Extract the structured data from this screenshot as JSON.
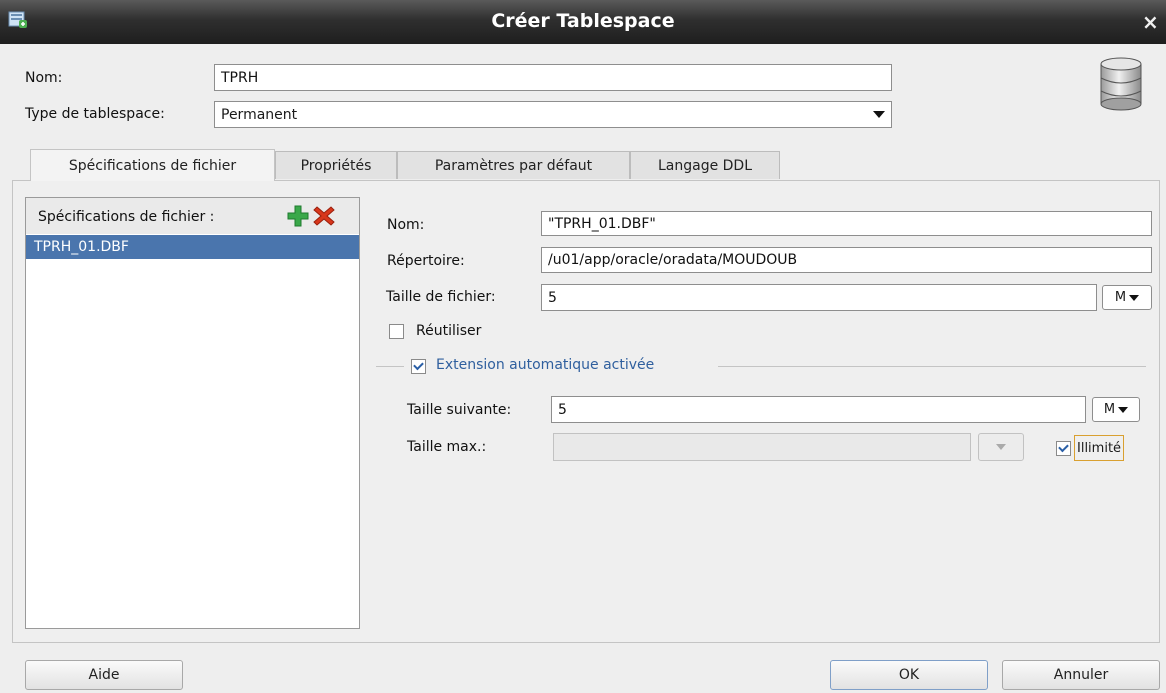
{
  "window": {
    "title": "Créer Tablespace",
    "close_glyph": "×"
  },
  "header": {
    "nom_label": "Nom:",
    "nom_value": "TPRH",
    "type_label": "Type de tablespace:",
    "type_value": "Permanent"
  },
  "tabs": [
    {
      "label": "Spécifications de fichier",
      "active": true
    },
    {
      "label": "Propriétés",
      "active": false
    },
    {
      "label": "Paramètres par défaut",
      "active": false
    },
    {
      "label": "Langage DDL",
      "active": false
    }
  ],
  "file_list": {
    "header_label": "Spécifications de fichier :",
    "items": [
      "TPRH_01.DBF"
    ]
  },
  "file_spec": {
    "nom_label": "Nom:",
    "nom_value": "\"TPRH_01.DBF\"",
    "repertoire_label": "Répertoire:",
    "repertoire_value": "/u01/app/oracle/oradata/MOUDOUB",
    "taille_label": "Taille de fichier:",
    "taille_value": "5",
    "taille_unit": "M",
    "reutiliser_label": "Réutiliser",
    "reutiliser_checked": false,
    "autoext_label": "Extension automatique activée",
    "autoext_checked": true,
    "suivante_label": "Taille suivante:",
    "suivante_value": "5",
    "suivante_unit": "M",
    "max_label": "Taille max.:",
    "max_value": "",
    "illimite_label": "Illimité",
    "illimite_checked": true
  },
  "footer": {
    "help_label": "Aide",
    "ok_label": "OK",
    "cancel_label": "Annuler"
  },
  "colors": {
    "titlebar": "#2f2f2f",
    "selection": "#4a75ad",
    "add_icon": "#3aa84a",
    "delete_icon": "#d8371c"
  }
}
